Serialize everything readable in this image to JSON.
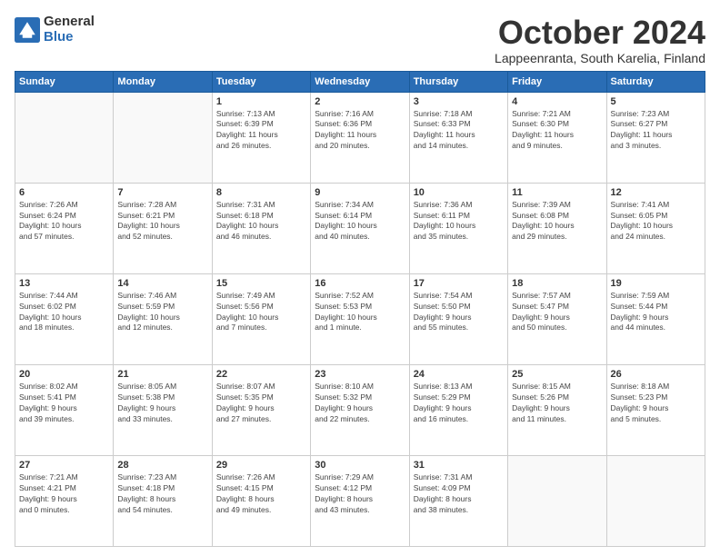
{
  "logo": {
    "general": "General",
    "blue": "Blue"
  },
  "title": "October 2024",
  "subtitle": "Lappeenranta, South Karelia, Finland",
  "weekdays": [
    "Sunday",
    "Monday",
    "Tuesday",
    "Wednesday",
    "Thursday",
    "Friday",
    "Saturday"
  ],
  "weeks": [
    [
      {
        "day": "",
        "info": ""
      },
      {
        "day": "",
        "info": ""
      },
      {
        "day": "1",
        "info": "Sunrise: 7:13 AM\nSunset: 6:39 PM\nDaylight: 11 hours\nand 26 minutes."
      },
      {
        "day": "2",
        "info": "Sunrise: 7:16 AM\nSunset: 6:36 PM\nDaylight: 11 hours\nand 20 minutes."
      },
      {
        "day": "3",
        "info": "Sunrise: 7:18 AM\nSunset: 6:33 PM\nDaylight: 11 hours\nand 14 minutes."
      },
      {
        "day": "4",
        "info": "Sunrise: 7:21 AM\nSunset: 6:30 PM\nDaylight: 11 hours\nand 9 minutes."
      },
      {
        "day": "5",
        "info": "Sunrise: 7:23 AM\nSunset: 6:27 PM\nDaylight: 11 hours\nand 3 minutes."
      }
    ],
    [
      {
        "day": "6",
        "info": "Sunrise: 7:26 AM\nSunset: 6:24 PM\nDaylight: 10 hours\nand 57 minutes."
      },
      {
        "day": "7",
        "info": "Sunrise: 7:28 AM\nSunset: 6:21 PM\nDaylight: 10 hours\nand 52 minutes."
      },
      {
        "day": "8",
        "info": "Sunrise: 7:31 AM\nSunset: 6:18 PM\nDaylight: 10 hours\nand 46 minutes."
      },
      {
        "day": "9",
        "info": "Sunrise: 7:34 AM\nSunset: 6:14 PM\nDaylight: 10 hours\nand 40 minutes."
      },
      {
        "day": "10",
        "info": "Sunrise: 7:36 AM\nSunset: 6:11 PM\nDaylight: 10 hours\nand 35 minutes."
      },
      {
        "day": "11",
        "info": "Sunrise: 7:39 AM\nSunset: 6:08 PM\nDaylight: 10 hours\nand 29 minutes."
      },
      {
        "day": "12",
        "info": "Sunrise: 7:41 AM\nSunset: 6:05 PM\nDaylight: 10 hours\nand 24 minutes."
      }
    ],
    [
      {
        "day": "13",
        "info": "Sunrise: 7:44 AM\nSunset: 6:02 PM\nDaylight: 10 hours\nand 18 minutes."
      },
      {
        "day": "14",
        "info": "Sunrise: 7:46 AM\nSunset: 5:59 PM\nDaylight: 10 hours\nand 12 minutes."
      },
      {
        "day": "15",
        "info": "Sunrise: 7:49 AM\nSunset: 5:56 PM\nDaylight: 10 hours\nand 7 minutes."
      },
      {
        "day": "16",
        "info": "Sunrise: 7:52 AM\nSunset: 5:53 PM\nDaylight: 10 hours\nand 1 minute."
      },
      {
        "day": "17",
        "info": "Sunrise: 7:54 AM\nSunset: 5:50 PM\nDaylight: 9 hours\nand 55 minutes."
      },
      {
        "day": "18",
        "info": "Sunrise: 7:57 AM\nSunset: 5:47 PM\nDaylight: 9 hours\nand 50 minutes."
      },
      {
        "day": "19",
        "info": "Sunrise: 7:59 AM\nSunset: 5:44 PM\nDaylight: 9 hours\nand 44 minutes."
      }
    ],
    [
      {
        "day": "20",
        "info": "Sunrise: 8:02 AM\nSunset: 5:41 PM\nDaylight: 9 hours\nand 39 minutes."
      },
      {
        "day": "21",
        "info": "Sunrise: 8:05 AM\nSunset: 5:38 PM\nDaylight: 9 hours\nand 33 minutes."
      },
      {
        "day": "22",
        "info": "Sunrise: 8:07 AM\nSunset: 5:35 PM\nDaylight: 9 hours\nand 27 minutes."
      },
      {
        "day": "23",
        "info": "Sunrise: 8:10 AM\nSunset: 5:32 PM\nDaylight: 9 hours\nand 22 minutes."
      },
      {
        "day": "24",
        "info": "Sunrise: 8:13 AM\nSunset: 5:29 PM\nDaylight: 9 hours\nand 16 minutes."
      },
      {
        "day": "25",
        "info": "Sunrise: 8:15 AM\nSunset: 5:26 PM\nDaylight: 9 hours\nand 11 minutes."
      },
      {
        "day": "26",
        "info": "Sunrise: 8:18 AM\nSunset: 5:23 PM\nDaylight: 9 hours\nand 5 minutes."
      }
    ],
    [
      {
        "day": "27",
        "info": "Sunrise: 7:21 AM\nSunset: 4:21 PM\nDaylight: 9 hours\nand 0 minutes."
      },
      {
        "day": "28",
        "info": "Sunrise: 7:23 AM\nSunset: 4:18 PM\nDaylight: 8 hours\nand 54 minutes."
      },
      {
        "day": "29",
        "info": "Sunrise: 7:26 AM\nSunset: 4:15 PM\nDaylight: 8 hours\nand 49 minutes."
      },
      {
        "day": "30",
        "info": "Sunrise: 7:29 AM\nSunset: 4:12 PM\nDaylight: 8 hours\nand 43 minutes."
      },
      {
        "day": "31",
        "info": "Sunrise: 7:31 AM\nSunset: 4:09 PM\nDaylight: 8 hours\nand 38 minutes."
      },
      {
        "day": "",
        "info": ""
      },
      {
        "day": "",
        "info": ""
      }
    ]
  ]
}
